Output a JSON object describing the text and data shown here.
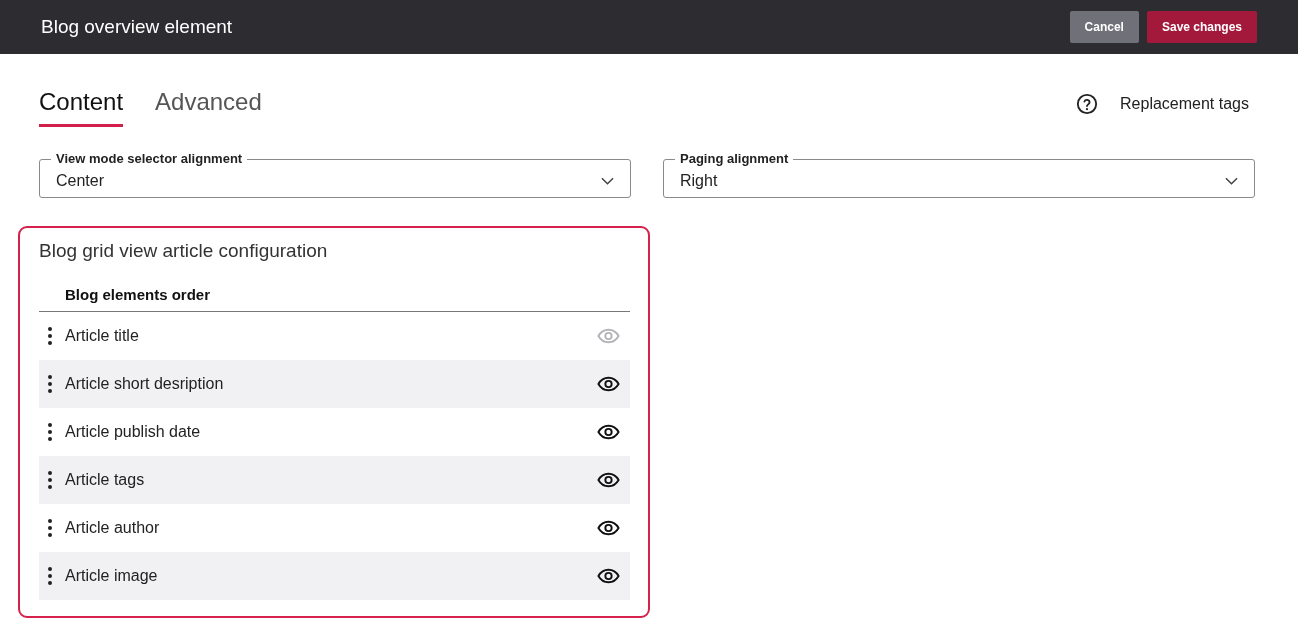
{
  "header": {
    "title": "Blog overview element",
    "buttons": [
      {
        "label": "Cancel",
        "kind": "secondary"
      },
      {
        "label": "Save changes",
        "kind": "primary"
      }
    ]
  },
  "tabs": [
    {
      "label": "Content",
      "selected": true
    },
    {
      "label": "Advanced",
      "selected": false
    }
  ],
  "replacement_tags": {
    "label": "Replacement tags"
  },
  "selects": [
    {
      "label": "View mode selector alignment",
      "value": "Center"
    },
    {
      "label": "Paging alignment",
      "value": "Right"
    }
  ],
  "card": {
    "title": "Blog grid view article configuration",
    "list_header": "Blog elements order",
    "items": [
      {
        "label": "Article title",
        "disabled": true
      },
      {
        "label": "Article short desription",
        "disabled": false
      },
      {
        "label": "Article publish date",
        "disabled": false
      },
      {
        "label": "Article tags",
        "disabled": false
      },
      {
        "label": "Article author",
        "disabled": false
      },
      {
        "label": "Article image",
        "disabled": false
      }
    ]
  }
}
